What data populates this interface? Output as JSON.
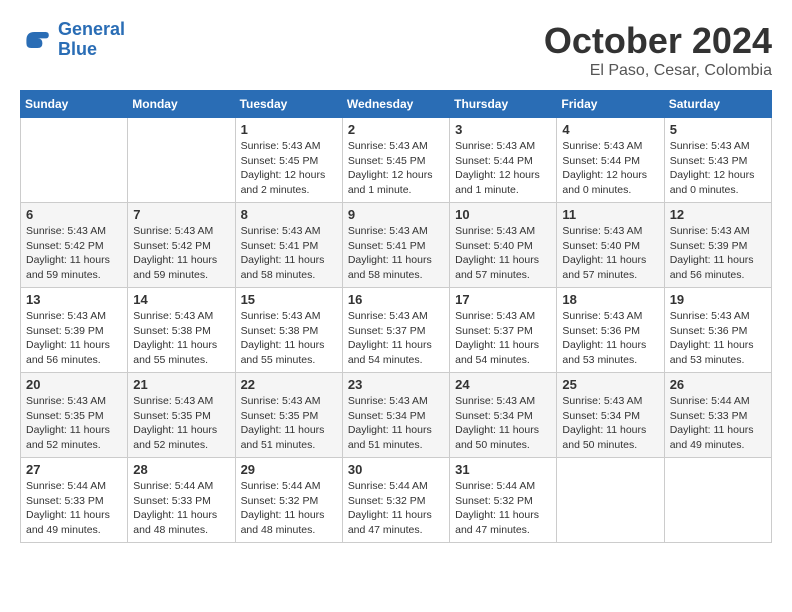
{
  "logo": {
    "text_general": "General",
    "text_blue": "Blue"
  },
  "header": {
    "month": "October 2024",
    "location": "El Paso, Cesar, Colombia"
  },
  "weekdays": [
    "Sunday",
    "Monday",
    "Tuesday",
    "Wednesday",
    "Thursday",
    "Friday",
    "Saturday"
  ],
  "weeks": [
    [
      {
        "day": "",
        "sunrise": "",
        "sunset": "",
        "daylight": ""
      },
      {
        "day": "",
        "sunrise": "",
        "sunset": "",
        "daylight": ""
      },
      {
        "day": "1",
        "sunrise": "Sunrise: 5:43 AM",
        "sunset": "Sunset: 5:45 PM",
        "daylight": "Daylight: 12 hours and 2 minutes."
      },
      {
        "day": "2",
        "sunrise": "Sunrise: 5:43 AM",
        "sunset": "Sunset: 5:45 PM",
        "daylight": "Daylight: 12 hours and 1 minute."
      },
      {
        "day": "3",
        "sunrise": "Sunrise: 5:43 AM",
        "sunset": "Sunset: 5:44 PM",
        "daylight": "Daylight: 12 hours and 1 minute."
      },
      {
        "day": "4",
        "sunrise": "Sunrise: 5:43 AM",
        "sunset": "Sunset: 5:44 PM",
        "daylight": "Daylight: 12 hours and 0 minutes."
      },
      {
        "day": "5",
        "sunrise": "Sunrise: 5:43 AM",
        "sunset": "Sunset: 5:43 PM",
        "daylight": "Daylight: 12 hours and 0 minutes."
      }
    ],
    [
      {
        "day": "6",
        "sunrise": "Sunrise: 5:43 AM",
        "sunset": "Sunset: 5:42 PM",
        "daylight": "Daylight: 11 hours and 59 minutes."
      },
      {
        "day": "7",
        "sunrise": "Sunrise: 5:43 AM",
        "sunset": "Sunset: 5:42 PM",
        "daylight": "Daylight: 11 hours and 59 minutes."
      },
      {
        "day": "8",
        "sunrise": "Sunrise: 5:43 AM",
        "sunset": "Sunset: 5:41 PM",
        "daylight": "Daylight: 11 hours and 58 minutes."
      },
      {
        "day": "9",
        "sunrise": "Sunrise: 5:43 AM",
        "sunset": "Sunset: 5:41 PM",
        "daylight": "Daylight: 11 hours and 58 minutes."
      },
      {
        "day": "10",
        "sunrise": "Sunrise: 5:43 AM",
        "sunset": "Sunset: 5:40 PM",
        "daylight": "Daylight: 11 hours and 57 minutes."
      },
      {
        "day": "11",
        "sunrise": "Sunrise: 5:43 AM",
        "sunset": "Sunset: 5:40 PM",
        "daylight": "Daylight: 11 hours and 57 minutes."
      },
      {
        "day": "12",
        "sunrise": "Sunrise: 5:43 AM",
        "sunset": "Sunset: 5:39 PM",
        "daylight": "Daylight: 11 hours and 56 minutes."
      }
    ],
    [
      {
        "day": "13",
        "sunrise": "Sunrise: 5:43 AM",
        "sunset": "Sunset: 5:39 PM",
        "daylight": "Daylight: 11 hours and 56 minutes."
      },
      {
        "day": "14",
        "sunrise": "Sunrise: 5:43 AM",
        "sunset": "Sunset: 5:38 PM",
        "daylight": "Daylight: 11 hours and 55 minutes."
      },
      {
        "day": "15",
        "sunrise": "Sunrise: 5:43 AM",
        "sunset": "Sunset: 5:38 PM",
        "daylight": "Daylight: 11 hours and 55 minutes."
      },
      {
        "day": "16",
        "sunrise": "Sunrise: 5:43 AM",
        "sunset": "Sunset: 5:37 PM",
        "daylight": "Daylight: 11 hours and 54 minutes."
      },
      {
        "day": "17",
        "sunrise": "Sunrise: 5:43 AM",
        "sunset": "Sunset: 5:37 PM",
        "daylight": "Daylight: 11 hours and 54 minutes."
      },
      {
        "day": "18",
        "sunrise": "Sunrise: 5:43 AM",
        "sunset": "Sunset: 5:36 PM",
        "daylight": "Daylight: 11 hours and 53 minutes."
      },
      {
        "day": "19",
        "sunrise": "Sunrise: 5:43 AM",
        "sunset": "Sunset: 5:36 PM",
        "daylight": "Daylight: 11 hours and 53 minutes."
      }
    ],
    [
      {
        "day": "20",
        "sunrise": "Sunrise: 5:43 AM",
        "sunset": "Sunset: 5:35 PM",
        "daylight": "Daylight: 11 hours and 52 minutes."
      },
      {
        "day": "21",
        "sunrise": "Sunrise: 5:43 AM",
        "sunset": "Sunset: 5:35 PM",
        "daylight": "Daylight: 11 hours and 52 minutes."
      },
      {
        "day": "22",
        "sunrise": "Sunrise: 5:43 AM",
        "sunset": "Sunset: 5:35 PM",
        "daylight": "Daylight: 11 hours and 51 minutes."
      },
      {
        "day": "23",
        "sunrise": "Sunrise: 5:43 AM",
        "sunset": "Sunset: 5:34 PM",
        "daylight": "Daylight: 11 hours and 51 minutes."
      },
      {
        "day": "24",
        "sunrise": "Sunrise: 5:43 AM",
        "sunset": "Sunset: 5:34 PM",
        "daylight": "Daylight: 11 hours and 50 minutes."
      },
      {
        "day": "25",
        "sunrise": "Sunrise: 5:43 AM",
        "sunset": "Sunset: 5:34 PM",
        "daylight": "Daylight: 11 hours and 50 minutes."
      },
      {
        "day": "26",
        "sunrise": "Sunrise: 5:44 AM",
        "sunset": "Sunset: 5:33 PM",
        "daylight": "Daylight: 11 hours and 49 minutes."
      }
    ],
    [
      {
        "day": "27",
        "sunrise": "Sunrise: 5:44 AM",
        "sunset": "Sunset: 5:33 PM",
        "daylight": "Daylight: 11 hours and 49 minutes."
      },
      {
        "day": "28",
        "sunrise": "Sunrise: 5:44 AM",
        "sunset": "Sunset: 5:33 PM",
        "daylight": "Daylight: 11 hours and 48 minutes."
      },
      {
        "day": "29",
        "sunrise": "Sunrise: 5:44 AM",
        "sunset": "Sunset: 5:32 PM",
        "daylight": "Daylight: 11 hours and 48 minutes."
      },
      {
        "day": "30",
        "sunrise": "Sunrise: 5:44 AM",
        "sunset": "Sunset: 5:32 PM",
        "daylight": "Daylight: 11 hours and 47 minutes."
      },
      {
        "day": "31",
        "sunrise": "Sunrise: 5:44 AM",
        "sunset": "Sunset: 5:32 PM",
        "daylight": "Daylight: 11 hours and 47 minutes."
      },
      {
        "day": "",
        "sunrise": "",
        "sunset": "",
        "daylight": ""
      },
      {
        "day": "",
        "sunrise": "",
        "sunset": "",
        "daylight": ""
      }
    ]
  ]
}
